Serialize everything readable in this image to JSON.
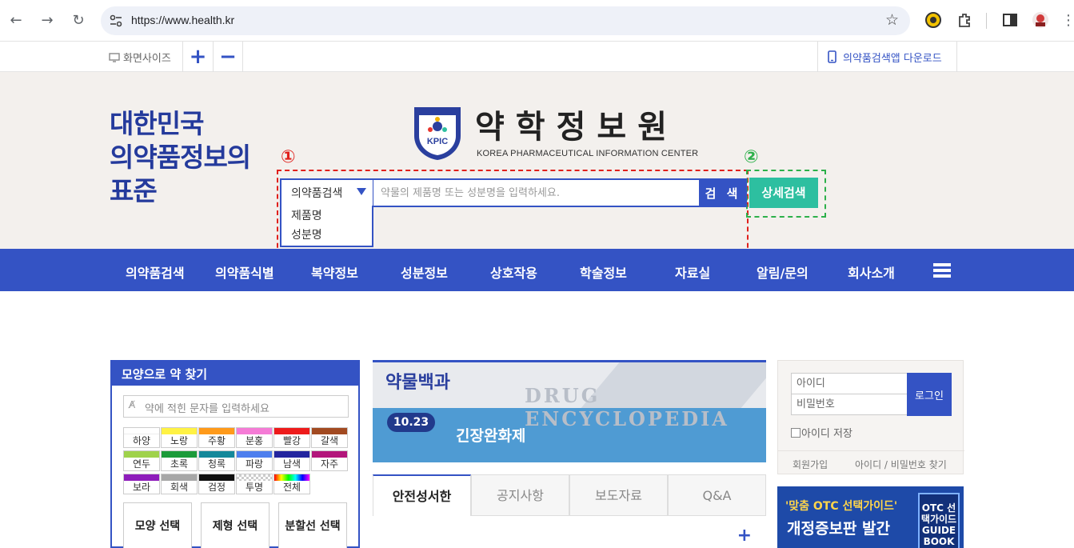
{
  "browser": {
    "url": "https://www.health.kr"
  },
  "utilbar": {
    "screen_size_label": "화면사이즈",
    "zoom_in": "+",
    "zoom_out": "−",
    "app_download": "의약품검색앱 다운로드"
  },
  "header": {
    "slogan": [
      "대한민국",
      "의약품정보의",
      "표준"
    ],
    "logo_kr": "약학정보원",
    "logo_en": "KOREA PHARMACEUTICAL INFORMATION CENTER",
    "emblem_text": "KPIC"
  },
  "annotations": {
    "num1": "①",
    "num2": "②",
    "num1_color": "#e0201c",
    "num2_color": "#2cb04a"
  },
  "search": {
    "category_selected": "의약품검색",
    "category_options": [
      "제품명",
      "성분명"
    ],
    "placeholder": "약물의 제품명 또는 성분명을 입력하세요.",
    "button": "검 색",
    "detail_button": "상세검색"
  },
  "mainnav": {
    "items": [
      "의약품검색",
      "의약품식별",
      "복약정보",
      "성분정보",
      "상호작용",
      "학술정보",
      "자료실",
      "알림/문의",
      "회사소개"
    ]
  },
  "shape_search": {
    "title": "모양으로 약 찾기",
    "imprint_placeholder": "약에 적힌 문자를 입력하세요",
    "colors": [
      {
        "label": "하양",
        "color": "#ffffff"
      },
      {
        "label": "노랑",
        "color": "#fff244"
      },
      {
        "label": "주황",
        "color": "#ff9a1a"
      },
      {
        "label": "분홍",
        "color": "#f57bd6"
      },
      {
        "label": "빨강",
        "color": "#ee1b1b"
      },
      {
        "label": "갈색",
        "color": "#a24a21"
      },
      {
        "label": "연두",
        "color": "#9fd24b"
      },
      {
        "label": "초록",
        "color": "#1c9b3a"
      },
      {
        "label": "청록",
        "color": "#14889a"
      },
      {
        "label": "파랑",
        "color": "#4e7fee"
      },
      {
        "label": "남색",
        "color": "#23259f"
      },
      {
        "label": "자주",
        "color": "#b3167b"
      },
      {
        "label": "보라",
        "color": "#8e1dbb"
      },
      {
        "label": "회색",
        "color": "#a7a7a7"
      },
      {
        "label": "검정",
        "color": "#111111"
      },
      {
        "label": "투명",
        "color": "checker"
      },
      {
        "label": "전체",
        "color": "rainbow"
      }
    ],
    "select_buttons": [
      "모양 선택",
      "제형 선택",
      "분할선 선택"
    ]
  },
  "encyclopedia": {
    "title": "약물백과",
    "eng_title": "DRUG ENCYCLOPEDIA",
    "date": "10.23",
    "term": "긴장완화제"
  },
  "notice_tabs": {
    "tabs": [
      "안전성서한",
      "공지사항",
      "보도자료",
      "Q&A"
    ],
    "active_index": 0,
    "more": "+"
  },
  "login": {
    "id_placeholder": "아이디",
    "pw_placeholder": "비밀번호",
    "button": "로그인",
    "save_id": "아이디 저장",
    "signup": "회원가입",
    "find": "아이디 / 비밀번호 찾기"
  },
  "otc_banner": {
    "line1": "'맞춤 OTC 선택가이드'",
    "line2": "개정증보판 발간",
    "book_text": "OTC 선택가이드 GUIDE BOOK"
  },
  "colors": {
    "brand_blue": "#3453c4",
    "slogan_blue": "#243a9c",
    "detail_teal": "#2dbfa0",
    "header_bg": "#f3f0ed"
  }
}
